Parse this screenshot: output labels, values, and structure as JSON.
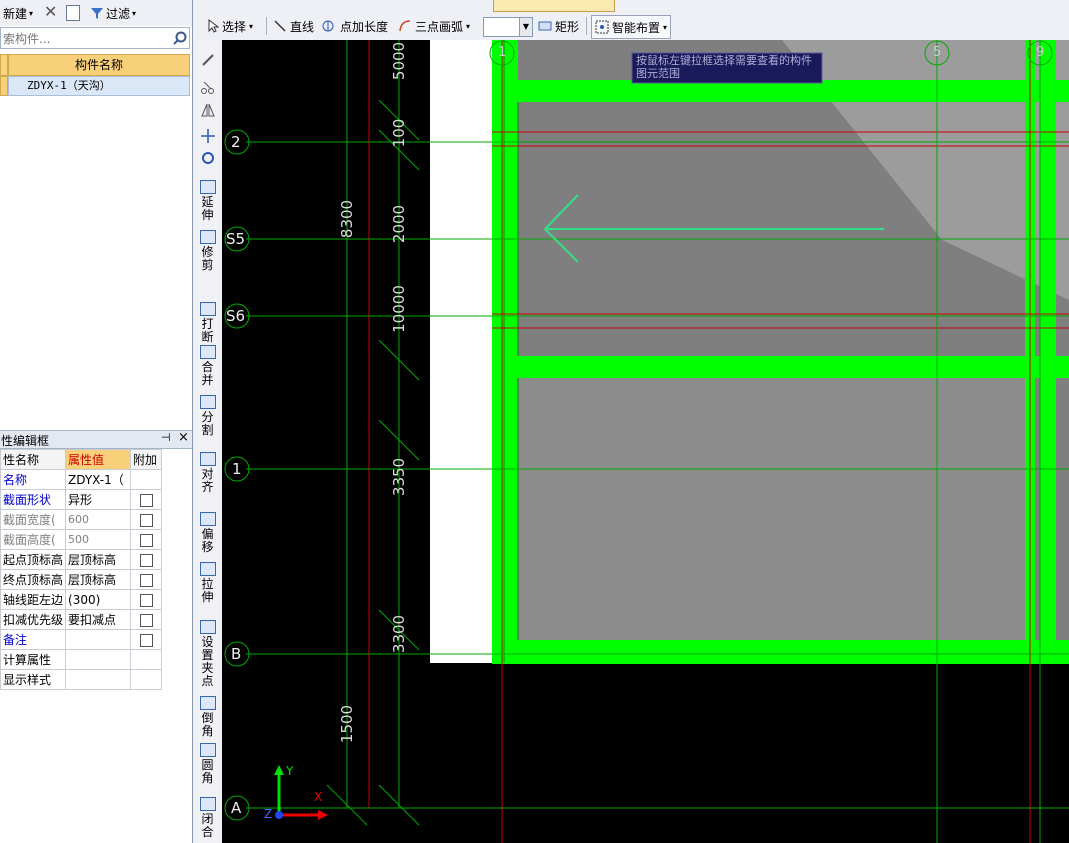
{
  "left_toolbar": {
    "new_label": "新建",
    "filter_label": "过滤"
  },
  "search": {
    "placeholder": "索构件..."
  },
  "component_list": {
    "header": "构件名称",
    "rows": [
      "ZDYX-1（天沟）"
    ]
  },
  "property_panel": {
    "title": "性编辑框",
    "pin_glyph": "⊣",
    "close_glyph": "×",
    "columns": [
      "性名称",
      "属性值",
      "附加"
    ],
    "rows": [
      {
        "name": "名称",
        "value": "ZDYX-1（",
        "has_check": false,
        "name_color": "#0000cc"
      },
      {
        "name": "截面形状",
        "value": "异形",
        "has_check": true,
        "name_color": "#0000cc"
      },
      {
        "name": "截面宽度(",
        "value": "600",
        "has_check": true,
        "name_color": "#808080"
      },
      {
        "name": "截面高度(",
        "value": "500",
        "has_check": true,
        "name_color": "#808080"
      },
      {
        "name": "起点顶标高",
        "value": "层顶标高",
        "has_check": true,
        "name_color": "#000000"
      },
      {
        "name": "终点顶标高",
        "value": "层顶标高",
        "has_check": true,
        "name_color": "#000000"
      },
      {
        "name": "轴线距左边",
        "value": "(300)",
        "has_check": true,
        "name_color": "#000000"
      },
      {
        "name": "扣减优先级",
        "value": "要扣减点",
        "has_check": true,
        "name_color": "#000000"
      },
      {
        "name": "备注",
        "value": "",
        "has_check": true,
        "name_color": "#0000cc"
      },
      {
        "name": "计算属性",
        "value": "",
        "has_check": false,
        "name_color": "#000000"
      },
      {
        "name": "显示样式",
        "value": "",
        "has_check": false,
        "name_color": "#000000"
      }
    ]
  },
  "top_toolbar": {
    "select_label": "选择",
    "line_label": "直线",
    "point_length_label": "点加长度",
    "arc_label": "三点画弧",
    "rect_label": "矩形",
    "smart_label": "智能布置"
  },
  "vertical_tools": [
    "延伸",
    "修剪",
    "打断",
    "合并",
    "分割",
    "对齐",
    "偏移",
    "拉伸",
    "设置夹点",
    "倒角",
    "圆角",
    "闭合"
  ],
  "canvas": {
    "tooltip": "按鼠标左键拉框选择需要查看的构件图元范围",
    "axis_labels": [
      "2",
      "S5",
      "S6",
      "1",
      "B",
      "A"
    ],
    "top_axis_labels": [
      "1",
      "5",
      "9"
    ],
    "dimensions_outer": [
      "8300",
      "1500"
    ],
    "dimensions_inner": [
      "5000",
      "100",
      "2000",
      "10000",
      "3350",
      "3300"
    ],
    "ucs": {
      "x": "X",
      "y": "Y",
      "z": "Z"
    }
  },
  "colors": {
    "beam_green": "#00ff00",
    "axis_red": "#cc0000",
    "grid_green": "#00aa00"
  }
}
